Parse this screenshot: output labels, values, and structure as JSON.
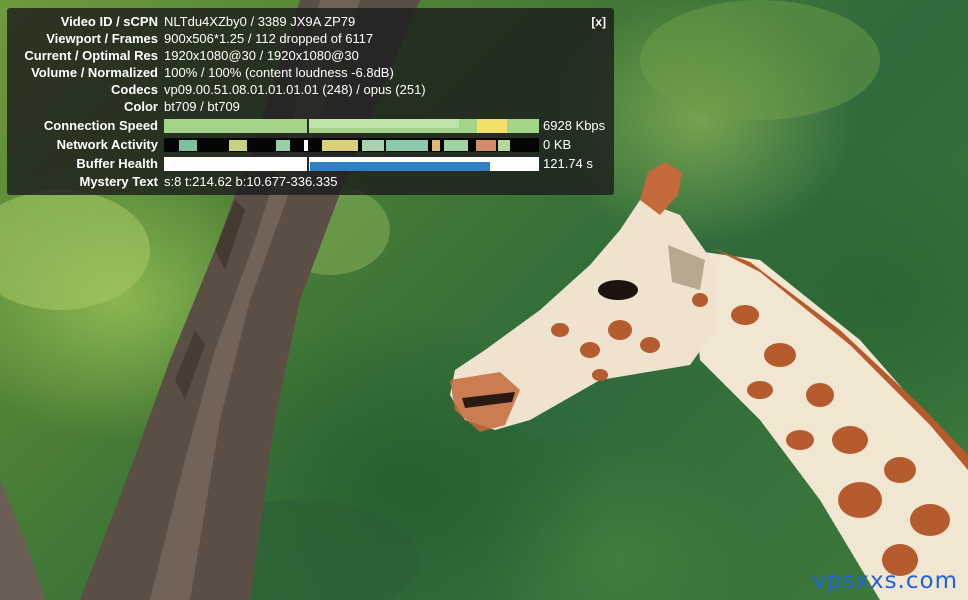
{
  "overlay": {
    "close_label": "[x]",
    "rows": [
      {
        "label": "Video ID / sCPN",
        "value": "NLTdu4XZby0 / 3389 JX9A ZP79"
      },
      {
        "label": "Viewport / Frames",
        "value": "900x506*1.25 / 112 dropped of 6117"
      },
      {
        "label": "Current / Optimal Res",
        "value": "1920x1080@30 / 1920x1080@30"
      },
      {
        "label": "Volume / Normalized",
        "value": "100% / 100% (content loudness -6.8dB)"
      },
      {
        "label": "Codecs",
        "value": "vp09.00.51.08.01.01.01.01 (248) / opus (251)"
      },
      {
        "label": "Color",
        "value": "bt709 / bt709"
      }
    ],
    "connection_speed": {
      "label": "Connection Speed",
      "value": "6928 Kbps"
    },
    "network_activity": {
      "label": "Network Activity",
      "value": "0 KB"
    },
    "buffer_health": {
      "label": "Buffer Health",
      "value": "121.74 s"
    },
    "mystery_text": {
      "label": "Mystery Text",
      "value": "s:8 t:214.62 b:10.677-336.335"
    }
  },
  "colors": {
    "overlay_bg": "#1c1c1c",
    "speed_bar": "#a4d489",
    "buffer_fill": "#2f7fc1",
    "watermark": "#1f62e0"
  },
  "watermark": {
    "text": "vpsxxs.com"
  }
}
